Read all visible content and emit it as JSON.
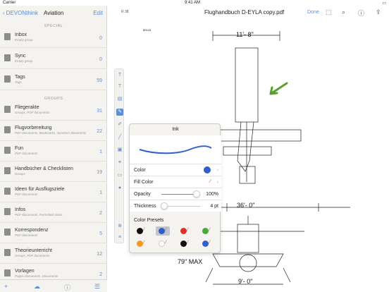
{
  "status_bar": {
    "carrier": "Carrier",
    "time": "9:41 AM"
  },
  "sidebar": {
    "back_label": "DEVONthink",
    "title": "Aviation",
    "edit_label": "Edit",
    "sections": {
      "special": "SPECIAL",
      "groups": "GROUPS"
    },
    "special_items": [
      {
        "name": "Inbox",
        "sub": "Empty group",
        "count": "0"
      },
      {
        "name": "Sync",
        "sub": "Empty group",
        "count": "0"
      },
      {
        "name": "Tags",
        "sub": "Tags",
        "count": "59"
      }
    ],
    "group_items": [
      {
        "name": "Fliegerakte",
        "sub": "Groups, PDF documents",
        "count": "31"
      },
      {
        "name": "Flugvorbereitung",
        "sub": "PDF documents, Bookmarks, Numbers documents",
        "count": "22"
      },
      {
        "name": "Fun",
        "sub": "PDF documents",
        "count": "1"
      },
      {
        "name": "Handbücher & Checklisten",
        "sub": "Groups",
        "count": "19"
      },
      {
        "name": "Ideen für Ausflugsziele",
        "sub": "PDF documents",
        "count": "1"
      },
      {
        "name": "Infos",
        "sub": "PDF documents, Formatted notes",
        "count": "2"
      },
      {
        "name": "Korrespondenz",
        "sub": "PDF documents",
        "count": "5"
      },
      {
        "name": "Theorieunterricht",
        "sub": "Groups, PDF documents",
        "count": "12"
      },
      {
        "name": "Vorlagen",
        "sub": "Pages documents, Documents",
        "count": "2"
      }
    ]
  },
  "document": {
    "title": "Flughandbuch D-EYLA copy.pdf",
    "done_label": "Done",
    "page_indicator": "R 38",
    "doc_ref": "89143",
    "dimensions": {
      "span": "11'- 8\"",
      "wing": "36'- 0\"",
      "tail": "9'- 0\"",
      "height": "79\" MAX"
    }
  },
  "ink_popover": {
    "title": "Ink",
    "color_label": "Color",
    "fill_label": "Fill Color",
    "opacity_label": "Opacity",
    "opacity_value": "100%",
    "opacity_level": 1.0,
    "thickness_label": "Thickness",
    "thickness_value": "4 pt",
    "thickness_level": 0.08,
    "presets_label": "Color Presets",
    "stroke_color": "#2f5fc9",
    "presets": [
      "#111111",
      "#2f5fc9",
      "#e0302a",
      "#49a83c",
      "#f39a21",
      "#ffffff",
      "#111111",
      "#2f5fc9"
    ]
  },
  "annotation_color": "#5aa02c"
}
